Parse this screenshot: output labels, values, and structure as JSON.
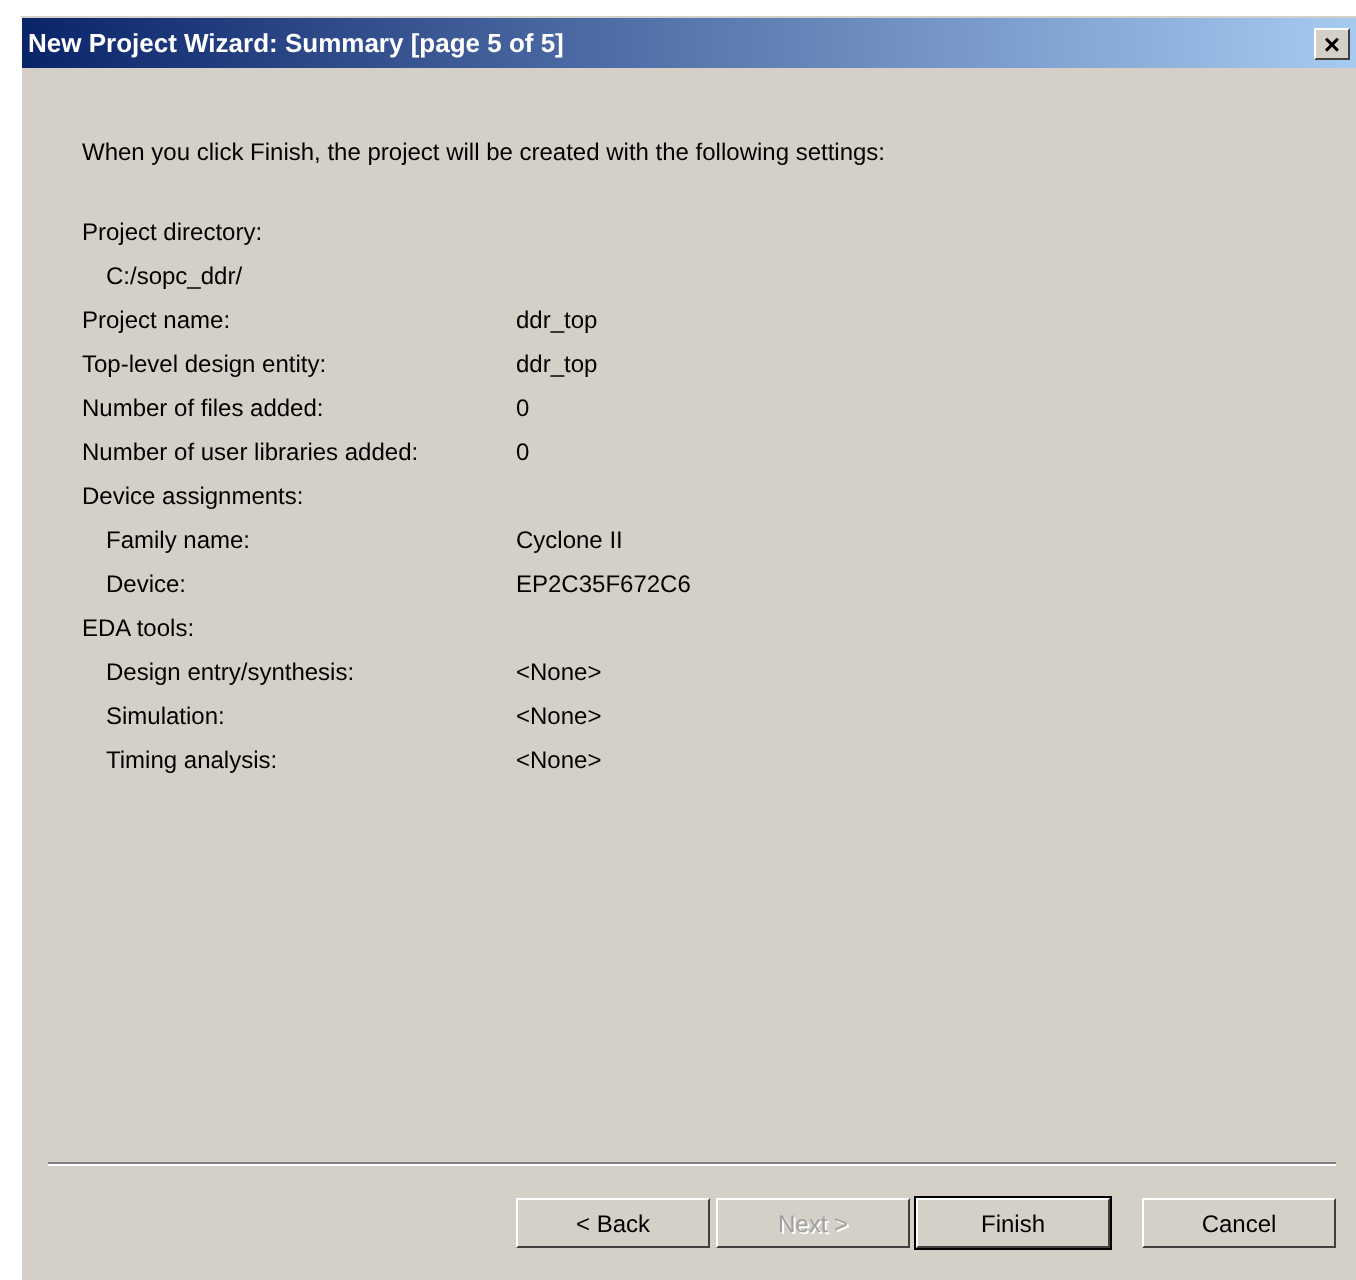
{
  "window": {
    "title": "New Project Wizard: Summary [page 5 of 5]",
    "close": "×"
  },
  "intro": "When you click Finish, the project will be created with the following settings:",
  "settings": [
    {
      "label": "Project directory:",
      "children": [
        {
          "label": "C:/sopc_ddr/"
        }
      ]
    },
    {
      "label": "Project name:",
      "value": "ddr_top"
    },
    {
      "label": "Top-level design entity:",
      "value": "ddr_top"
    },
    {
      "label": "Number of files added:",
      "value": "0"
    },
    {
      "label": "Number of user libraries added:",
      "value": "0"
    },
    {
      "label": "Device assignments:",
      "children": [
        {
          "label": "Family name:",
          "value": "Cyclone II"
        },
        {
          "label": "Device:",
          "value": "EP2C35F672C6"
        }
      ]
    },
    {
      "label": "EDA tools:",
      "children": [
        {
          "label": "Design entry/synthesis:",
          "value": "<None>"
        },
        {
          "label": "Simulation:",
          "value": "<None>"
        },
        {
          "label": "Timing analysis:",
          "value": "<None>"
        }
      ]
    }
  ],
  "buttons": [
    {
      "label": "< Back",
      "disabled": false,
      "default": false
    },
    {
      "label": "Next >",
      "disabled": true,
      "default": false
    },
    {
      "label": "Finish",
      "disabled": false,
      "default": true
    },
    {
      "label": "Cancel",
      "disabled": false,
      "default": false
    }
  ]
}
